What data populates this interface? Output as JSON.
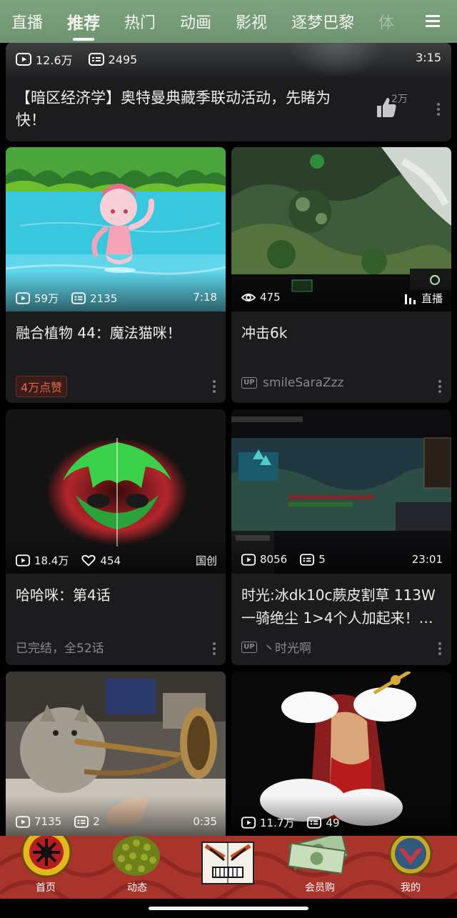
{
  "top_nav": {
    "tabs": [
      "直播",
      "推荐",
      "热门",
      "动画",
      "影视",
      "逐梦巴黎",
      "体"
    ],
    "active_tab": "推荐",
    "menu_icon": "menu-icon"
  },
  "top_card": {
    "views": "12.6万",
    "danmaku": "2495",
    "duration": "3:15",
    "title": "【暗区经济学】奥特曼典藏季联动活动，先睹为快！",
    "like_count": "2万"
  },
  "cards": [
    {
      "views": "59万",
      "danmaku": "2135",
      "right": "7:18",
      "title": "融合植物 44：魔法猫咪！",
      "badge": "4万点赞"
    },
    {
      "views": "475",
      "right": "直播",
      "title": "冲击6k",
      "author": "smileSaraZzz"
    },
    {
      "views": "18.4万",
      "likes": "454",
      "right": "国创",
      "title": "哈哈咪：第4话",
      "meta": "已完结，全52话"
    },
    {
      "views": "8056",
      "danmaku": "5",
      "right": "23:01",
      "title": "时光:冰dk10c蕨皮割草 113W 一骑绝尘 1>4个人加起来！…",
      "author": "丶时光啊"
    },
    {
      "views": "7135",
      "danmaku": "2",
      "right": "0:35"
    },
    {
      "views": "11.7万",
      "danmaku": "49"
    }
  ],
  "bottom_nav": {
    "items": [
      "首页",
      "动态",
      "会员购",
      "我的"
    ],
    "active": "首页"
  },
  "colors": {
    "top_nav_bg": "#7ea27f",
    "card_bg": "#1c1c1e",
    "bottom_nav_bg": "#a8342c",
    "badge_text": "#e0684f"
  }
}
